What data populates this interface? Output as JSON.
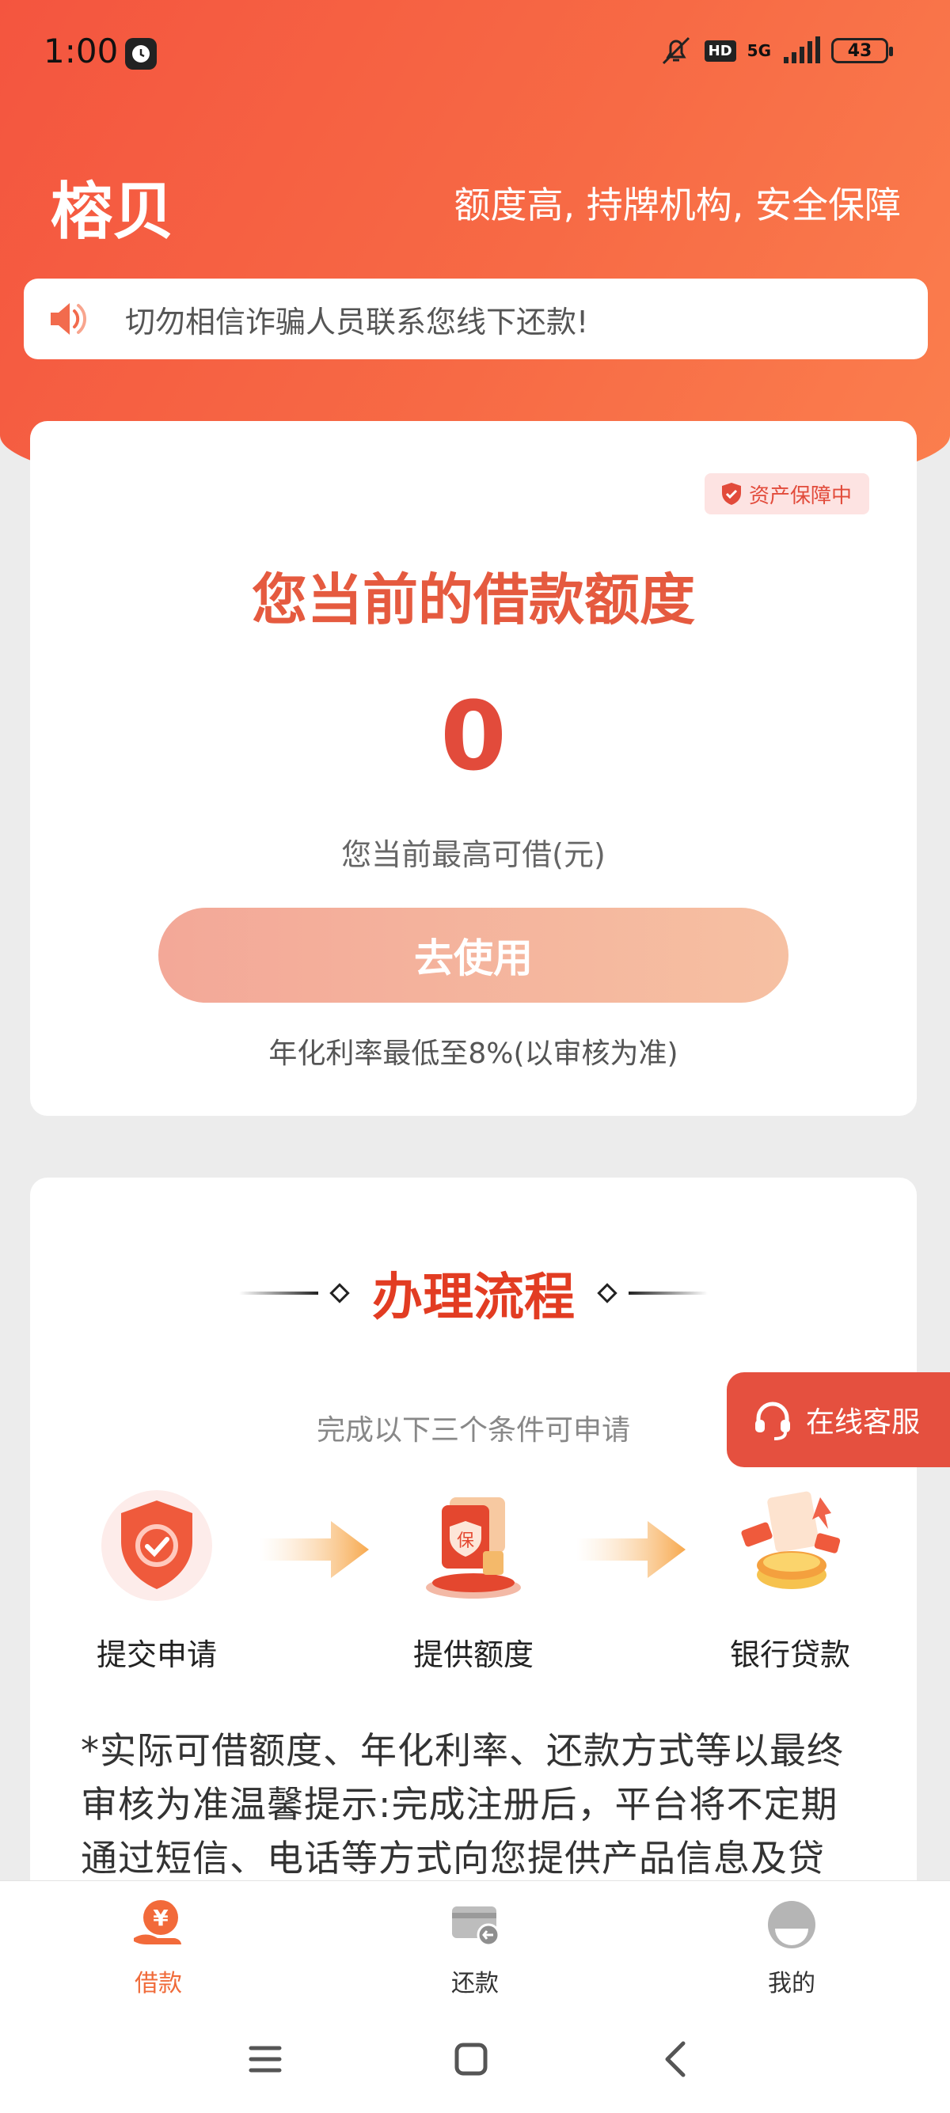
{
  "status_bar": {
    "time": "1:00",
    "network": "5G",
    "hd": "HD",
    "battery": "43"
  },
  "header": {
    "app_name": "榕贝",
    "slogan": "额度高, 持牌机构, 安全保障"
  },
  "notice": {
    "text": "切勿相信诈骗人员联系您线下还款!"
  },
  "limit_card": {
    "badge": "资产保障中",
    "heading": "您当前的借款额度",
    "amount": "0",
    "sub_label": "您当前最高可借(元)",
    "use_button": "去使用",
    "rate_note": "年化利率最低至8%(以审核为准)"
  },
  "process_card": {
    "title": "办理流程",
    "subtitle": "完成以下三个条件可申请",
    "steps": [
      {
        "label": "提交申请",
        "icon": "shield-check-icon"
      },
      {
        "label": "提供额度",
        "icon": "insurance-card-icon"
      },
      {
        "label": "银行贷款",
        "icon": "coins-icon"
      }
    ],
    "disclaimer": "*实际可借额度、年化利率、还款方式等以最终审核为准温馨提示:完成注册后，平台将不定期通过短信、电话等方式向您提供产品信息及贷"
  },
  "service_button": {
    "label": "在线客服"
  },
  "tab_bar": {
    "tabs": [
      {
        "label": "借款",
        "active": true,
        "icon": "yuan-hand-icon"
      },
      {
        "label": "还款",
        "active": false,
        "icon": "card-refund-icon"
      },
      {
        "label": "我的",
        "active": false,
        "icon": "profile-icon"
      }
    ]
  },
  "colors": {
    "primary": "#f4553f",
    "accent_text": "#e55a3f",
    "title_red": "#e23c22",
    "tab_active": "#f06b3a"
  }
}
